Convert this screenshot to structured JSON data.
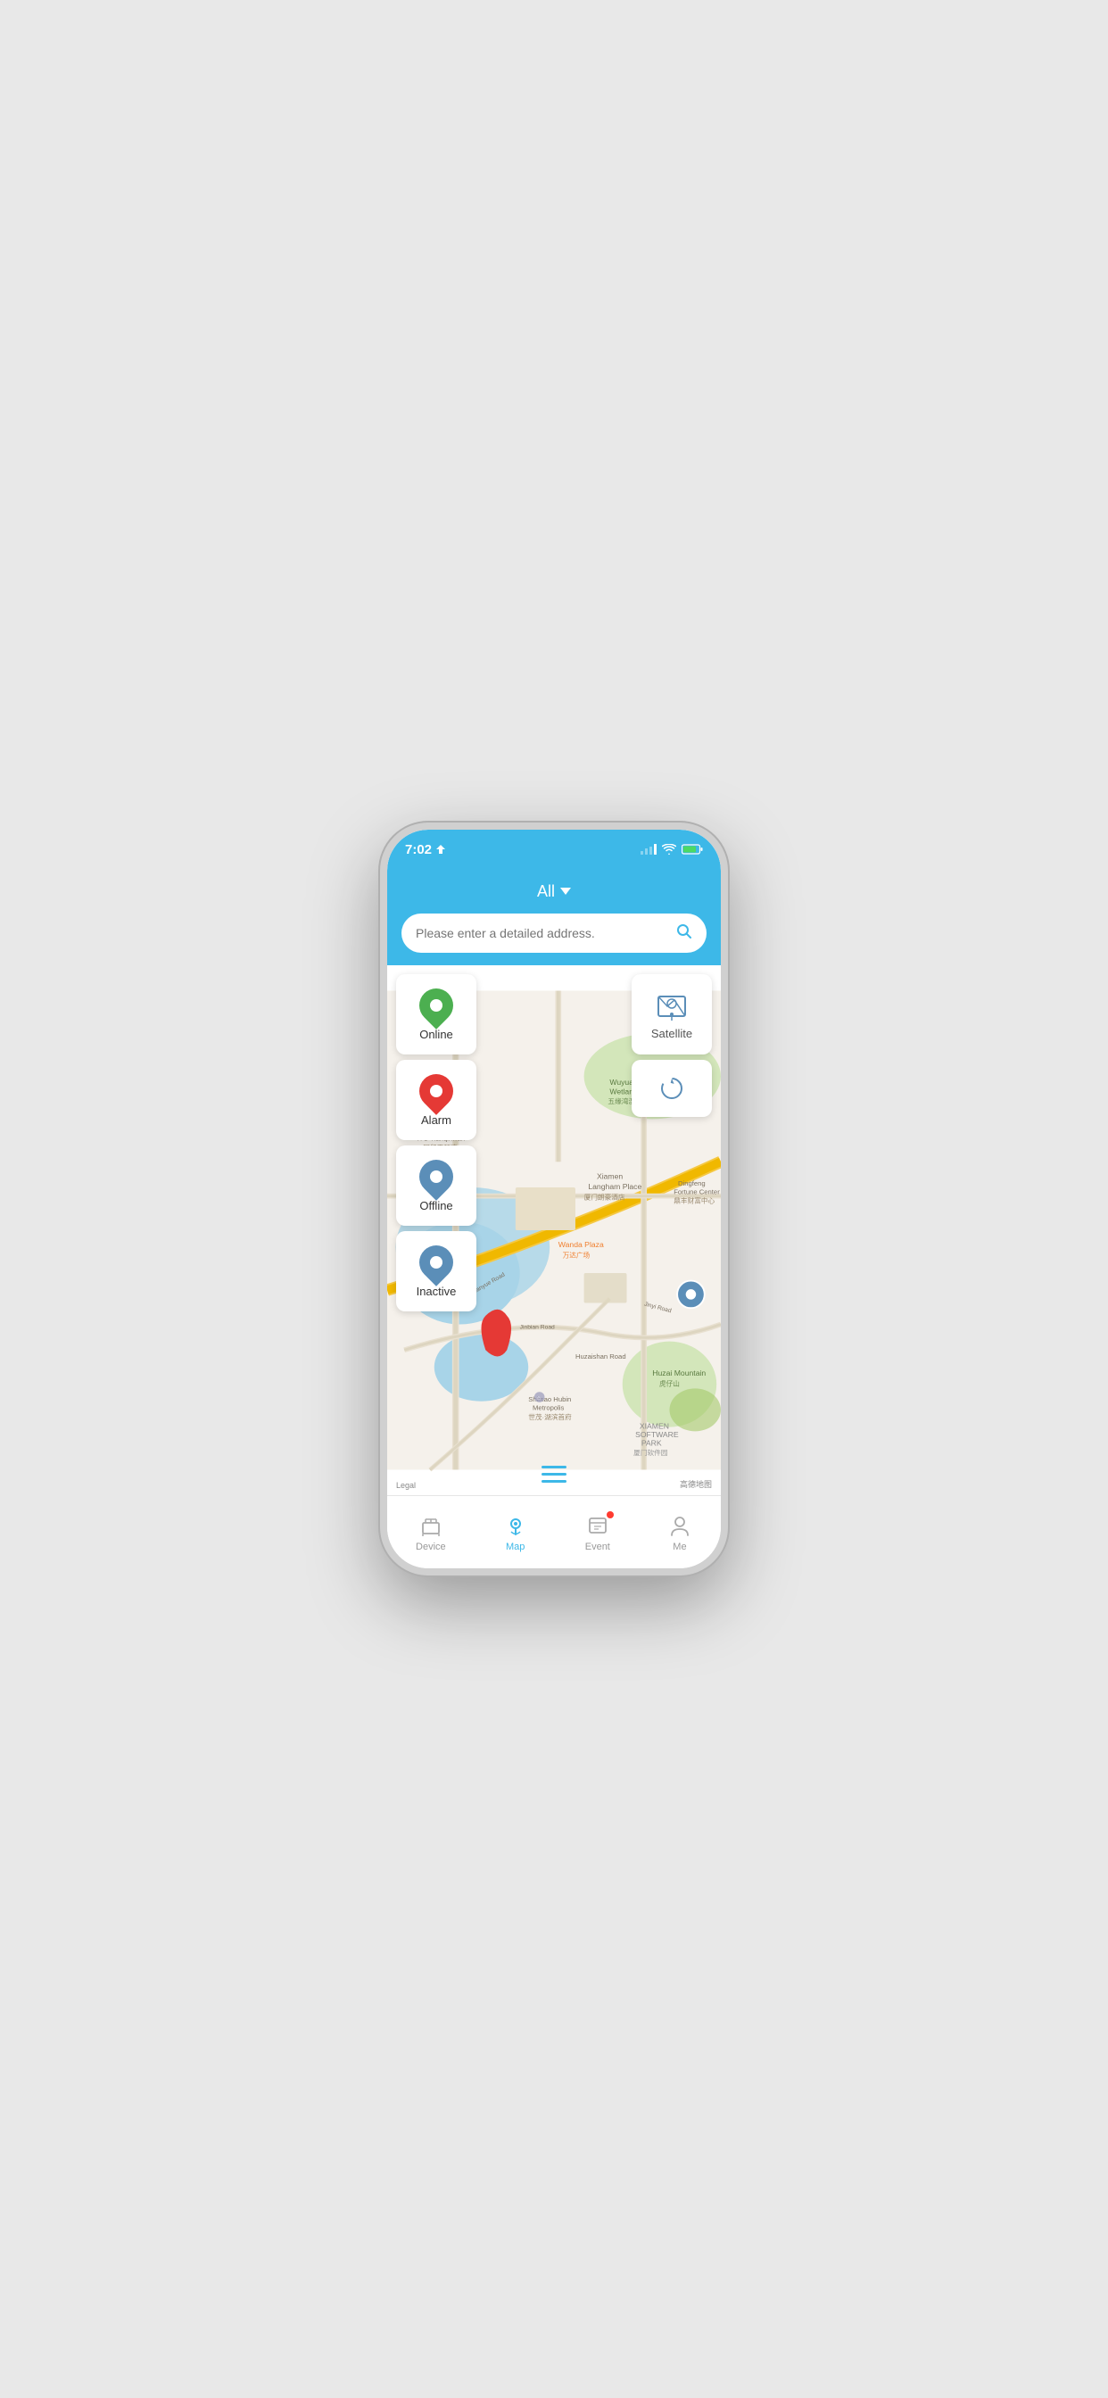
{
  "statusBar": {
    "time": "7:02",
    "locationIcon": "▸",
    "signal": "●●●●",
    "wifi": "wifi",
    "battery": "⚡"
  },
  "header": {
    "title": "All",
    "chevron": "▾"
  },
  "search": {
    "placeholder": "Please enter a detailed address.",
    "iconLabel": "search"
  },
  "filterButtons": [
    {
      "id": "online",
      "label": "Online",
      "color": "#4caf50"
    },
    {
      "id": "alarm",
      "label": "Alarm",
      "color": "#e53935"
    },
    {
      "id": "offline",
      "label": "Offline",
      "color": "#5b8eb8"
    },
    {
      "id": "inactive",
      "label": "Inactive",
      "color": "#5b8eb8"
    }
  ],
  "mapControls": {
    "satelliteLabel": "Satellite",
    "refreshTitle": "refresh"
  },
  "mapLabels": {
    "legal": "Legal",
    "credit": "高德地图"
  },
  "bottomNav": [
    {
      "id": "device",
      "label": "Device",
      "icon": "device",
      "active": false
    },
    {
      "id": "map",
      "label": "Map",
      "icon": "map",
      "active": true
    },
    {
      "id": "event",
      "label": "Event",
      "icon": "event",
      "active": false,
      "hasDot": true
    },
    {
      "id": "me",
      "label": "Me",
      "icon": "person",
      "active": false
    }
  ]
}
